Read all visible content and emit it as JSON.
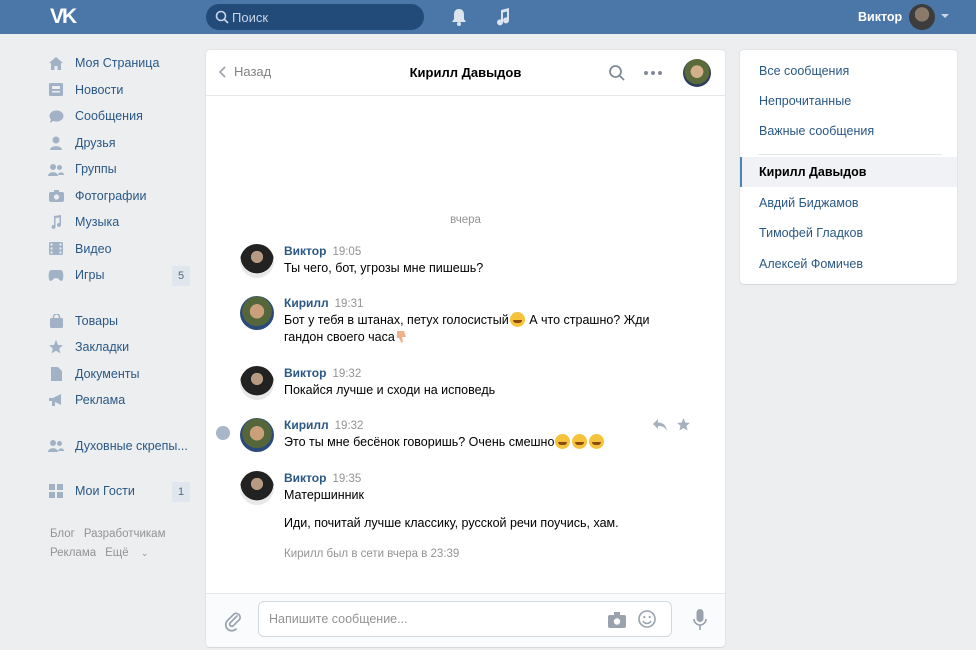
{
  "header": {
    "logo": "VK",
    "search_placeholder": "Поиск",
    "user_name": "Виктор"
  },
  "leftnav": {
    "items": [
      {
        "label": "Моя Страница",
        "icon": "home-icon"
      },
      {
        "label": "Новости",
        "icon": "news-icon"
      },
      {
        "label": "Сообщения",
        "icon": "messages-icon"
      },
      {
        "label": "Друзья",
        "icon": "friends-icon"
      },
      {
        "label": "Группы",
        "icon": "groups-icon"
      },
      {
        "label": "Фотографии",
        "icon": "camera-icon"
      },
      {
        "label": "Музыка",
        "icon": "music-icon"
      },
      {
        "label": "Видео",
        "icon": "video-icon"
      },
      {
        "label": "Игры",
        "icon": "gamepad-icon",
        "badge": "5"
      },
      {
        "label": "Товары",
        "icon": "bag-icon"
      },
      {
        "label": "Закладки",
        "icon": "star-icon"
      },
      {
        "label": "Документы",
        "icon": "document-icon"
      },
      {
        "label": "Реклама",
        "icon": "megaphone-icon"
      },
      {
        "label": "Духовные скрепы...",
        "icon": "group-icon"
      },
      {
        "label": "Мои Гости",
        "icon": "apps-icon",
        "badge": "1"
      }
    ],
    "footer": [
      "Блог",
      "Разработчикам",
      "Реклама",
      "Ещё"
    ]
  },
  "chat": {
    "back_label": "Назад",
    "peer_name": "Кирилл Давыдов",
    "day_label": "вчера",
    "messages": [
      {
        "author": "Виктор",
        "time": "19:05",
        "text": "Ты чего, бот, угрозы мне пишешь?"
      },
      {
        "author": "Кирилл",
        "time": "19:31",
        "text1": "Бот у тебя в штанах, петух голосистый",
        "text2": " А что страшно? Жди",
        "text3": "гандон своего часа"
      },
      {
        "author": "Виктор",
        "time": "19:32",
        "text": "Покайся лучше и сходи на исповедь"
      },
      {
        "author": "Кирилл",
        "time": "19:32",
        "text": "Это ты мне бесёнок говоришь? Очень смешно"
      },
      {
        "author": "Виктор",
        "time": "19:35",
        "text": "Матершинник",
        "text2": "Иди, почитай лучше классику, русской речи поучись, хам."
      }
    ],
    "online_status": "Кирилл был в сети вчера в 23:39",
    "input_placeholder": "Напишите сообщение..."
  },
  "rightnav": {
    "filters": [
      "Все сообщения",
      "Непрочитанные",
      "Важные сообщения"
    ],
    "active_dialog": "Кирилл Давыдов",
    "dialogs": [
      "Авдий Биджамов",
      "Тимофей Гладков",
      "Алексей Фомичев"
    ]
  },
  "colors": {
    "header_bg": "#4a76a8",
    "link": "#2a5885",
    "page_bg": "#edeef0",
    "muted": "#939393"
  }
}
